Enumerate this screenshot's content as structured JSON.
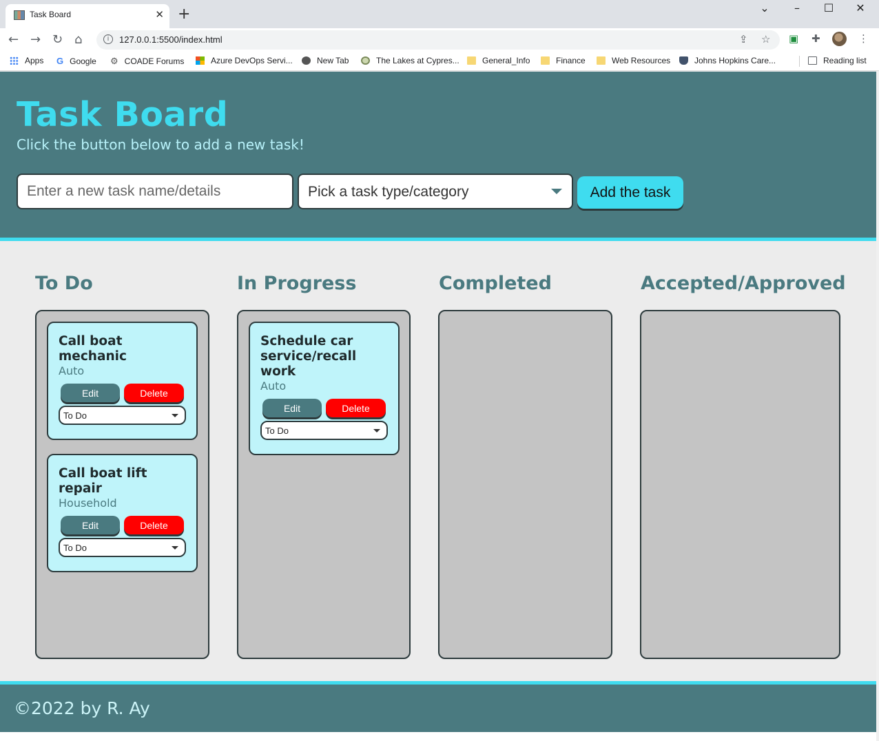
{
  "browser": {
    "tab_title": "Task Board",
    "new_tab_label": "+",
    "url": "127.0.0.1:5500/index.html",
    "bookmarks": [
      {
        "label": "Apps",
        "icon": "apps-icon"
      },
      {
        "label": "Google",
        "icon": "google-icon"
      },
      {
        "label": "COADE Forums",
        "icon": "gear-icon"
      },
      {
        "label": "Azure DevOps Servi...",
        "icon": "microsoft-icon"
      },
      {
        "label": "New Tab",
        "icon": "globe-icon"
      },
      {
        "label": "The Lakes at Cypres...",
        "icon": "lakes-icon"
      },
      {
        "label": "General_Info",
        "icon": "folder-icon"
      },
      {
        "label": "Finance",
        "icon": "folder-icon"
      },
      {
        "label": "Web Resources",
        "icon": "folder-icon"
      },
      {
        "label": "Johns Hopkins Care...",
        "icon": "shield-icon"
      }
    ],
    "reading_list": "Reading list"
  },
  "header": {
    "title": "Task Board",
    "subtitle": "Click the button below to add a new task!",
    "task_input_placeholder": "Enter a new task name/details",
    "type_select_placeholder": "Pick a task type/category",
    "add_button": "Add the task"
  },
  "columns": [
    {
      "title": "To Do"
    },
    {
      "title": "In Progress"
    },
    {
      "title": "Completed"
    },
    {
      "title": "Accepted/Approved"
    }
  ],
  "cards": [
    {
      "title": "Call boat mechanic",
      "type": "Auto",
      "edit": "Edit",
      "delete": "Delete",
      "status": "To Do"
    },
    {
      "title": "Call boat lift repair",
      "type": "Household",
      "edit": "Edit",
      "delete": "Delete",
      "status": "To Do"
    },
    {
      "title": "Schedule car service/recall work",
      "type": "Auto",
      "edit": "Edit",
      "delete": "Delete",
      "status": "To Do"
    }
  ],
  "footer": {
    "text": "©2022 by R. Ay"
  },
  "colors": {
    "header_bg": "#4a7a80",
    "accent_cyan": "#3fdcef",
    "card_bg": "#bff4fa",
    "column_bg": "#c4c4c4",
    "delete_red": "#ff0000"
  }
}
